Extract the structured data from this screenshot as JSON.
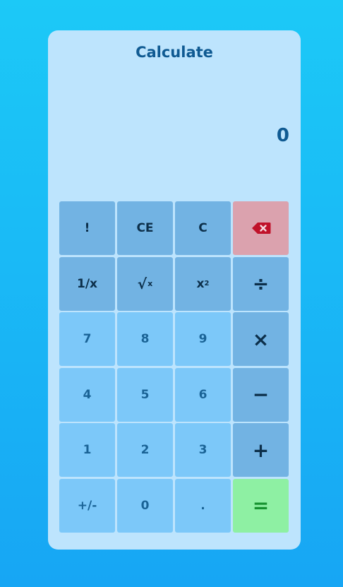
{
  "app": {
    "title": "Calculate"
  },
  "display": {
    "value": "0"
  },
  "keys": {
    "factorial": "!",
    "clear_entry": "CE",
    "clear": "C",
    "backspace_icon": "backspace-icon",
    "reciprocal": "1/x",
    "sqrt_symbol": "√",
    "sqrt_x": "x",
    "square_x": "x",
    "square_sup": "2",
    "divide": "÷",
    "seven": "7",
    "eight": "8",
    "nine": "9",
    "multiply": "×",
    "four": "4",
    "five": "5",
    "six": "6",
    "minus": "−",
    "one": "1",
    "two": "2",
    "three": "3",
    "plus": "+",
    "negate": "+/-",
    "zero": "0",
    "decimal": ".",
    "equals": "="
  },
  "colors": {
    "background_top": "#1cc9f7",
    "background_bottom": "#17a6f4",
    "panel": "#bde4fd",
    "function_key": "#72b3e3",
    "number_key": "#7cc8f9",
    "backspace_key": "#dba2ae",
    "equals_key": "#8ef0a3",
    "text_primary": "#0f5a92",
    "backspace_icon": "#c0122a"
  }
}
